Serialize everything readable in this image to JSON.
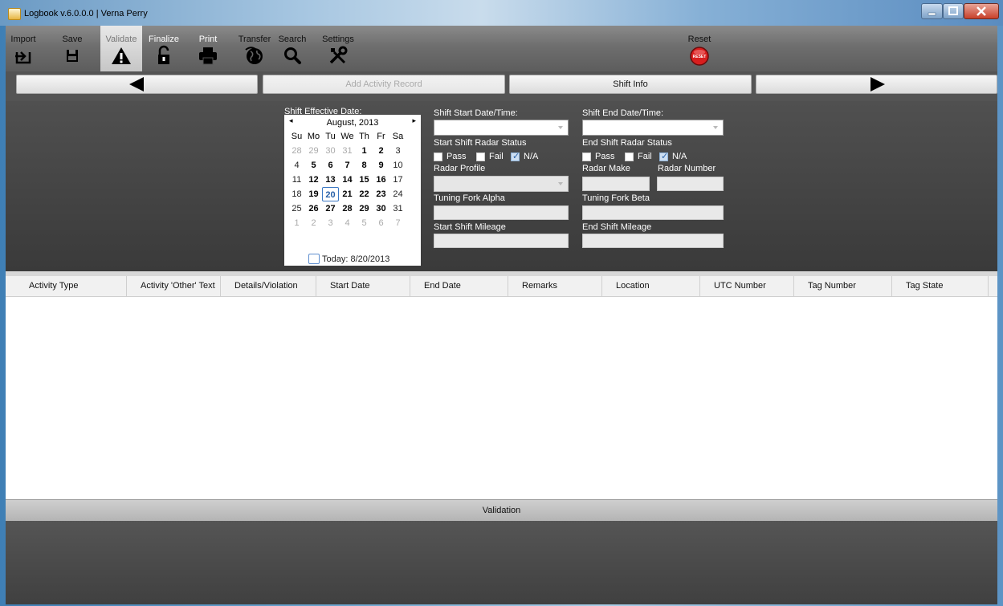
{
  "window": {
    "title": "Logbook v.6.0.0.0 | Verna Perry"
  },
  "toolbar": {
    "import": "Import",
    "save": "Save",
    "validate": "Validate",
    "finalize": "Finalize",
    "print": "Print",
    "transfer": "Transfer",
    "search": "Search",
    "settings": "Settings",
    "reset": "Reset",
    "reset_badge": "RESET"
  },
  "nav": {
    "add_activity": "Add Activity Record",
    "shift_info": "Shift Info"
  },
  "shift": {
    "effective_date_label": "Shift Effective Date:",
    "start_label": "Shift Start Date/Time:",
    "end_label": "Shift End Date/Time:",
    "start_radar_label": "Start Shift Radar Status",
    "end_radar_label": "End Shift Radar Status",
    "pass": "Pass",
    "fail": "Fail",
    "na": "N/A",
    "radar_profile_label": "Radar Profile",
    "radar_make_label": "Radar Make",
    "radar_number_label": "Radar Number",
    "tuning_alpha_label": "Tuning Fork Alpha",
    "tuning_beta_label": "Tuning Fork Beta",
    "start_mileage_label": "Start Shift Mileage",
    "end_mileage_label": "End Shift Mileage"
  },
  "calendar": {
    "month": "August, 2013",
    "prev": "◂",
    "next": "▸",
    "weekdays": [
      "Su",
      "Mo",
      "Tu",
      "We",
      "Th",
      "Fr",
      "Sa"
    ],
    "weeks": [
      [
        "28",
        "29",
        "30",
        "31",
        "1",
        "2",
        "3"
      ],
      [
        "4",
        "5",
        "6",
        "7",
        "8",
        "9",
        "10"
      ],
      [
        "11",
        "12",
        "13",
        "14",
        "15",
        "16",
        "17"
      ],
      [
        "18",
        "19",
        "20",
        "21",
        "22",
        "23",
        "24"
      ],
      [
        "25",
        "26",
        "27",
        "28",
        "29",
        "30",
        "31"
      ],
      [
        "1",
        "2",
        "3",
        "4",
        "5",
        "6",
        "7"
      ]
    ],
    "selected": "20",
    "today_label": "Today: 8/20/2013"
  },
  "grid": {
    "columns": [
      "Activity Type",
      "Activity 'Other' Text",
      "Details/Violation",
      "Start Date",
      "End Date",
      "Remarks",
      "Location",
      "UTC Number",
      "Tag Number",
      "Tag State"
    ]
  },
  "validation": {
    "label": "Validation"
  }
}
